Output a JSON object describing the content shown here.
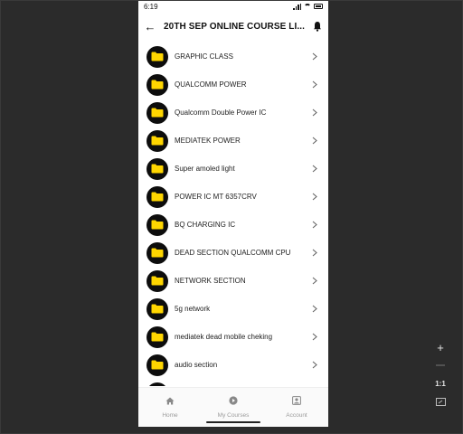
{
  "status_bar": {
    "time": "6:19"
  },
  "app_bar": {
    "title": "20TH SEP ONLINE COURSE LI..."
  },
  "folders": [
    {
      "label": "GRAPHIC CLASS"
    },
    {
      "label": "QUALCOMM POWER"
    },
    {
      "label": "Qualcomm Double  Power IC"
    },
    {
      "label": "MEDIATEK POWER"
    },
    {
      "label": "Super amoled light"
    },
    {
      "label": "POWER IC MT 6357CRV"
    },
    {
      "label": "BQ CHARGING IC"
    },
    {
      "label": "DEAD SECTION QUALCOMM CPU"
    },
    {
      "label": "NETWORK SECTION"
    },
    {
      "label": "5g network"
    },
    {
      "label": "mediatek dead mobile cheking"
    },
    {
      "label": "audio section"
    }
  ],
  "bottom_nav": {
    "home": "Home",
    "my_courses": "My Courses",
    "account": "Account"
  },
  "zoom": {
    "ratio": "1:1"
  },
  "colors": {
    "accent_yellow": "#FFD600",
    "avatar_bg": "#0d0d0d",
    "nav_inactive": "#9a9a9a"
  }
}
